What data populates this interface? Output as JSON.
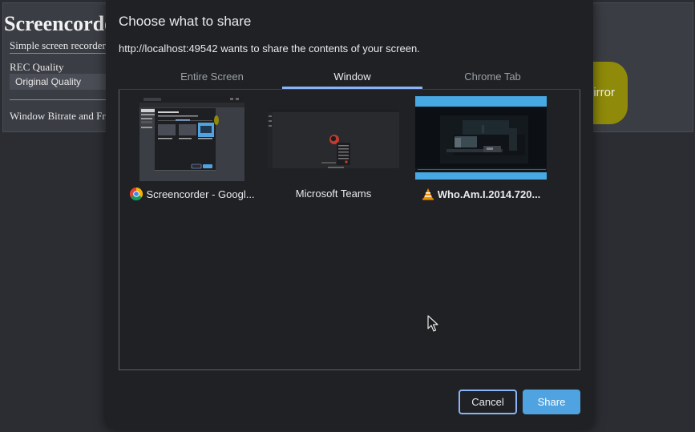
{
  "background_page": {
    "title": "Screencorde",
    "subtitle": "Simple screen recorder",
    "rec_quality_label": "REC Quality",
    "rec_quality_value": "Original Quality",
    "bitrate_label": "Window Bitrate and Fr",
    "mirror_button_label": "irror",
    "mirror_button_color": "#8f8a0a"
  },
  "dialog": {
    "title": "Choose what to share",
    "description": "http://localhost:49542 wants to share the contents of your screen.",
    "tabs": [
      {
        "label": "Entire Screen",
        "active": false
      },
      {
        "label": "Window",
        "active": true
      },
      {
        "label": "Chrome Tab",
        "active": false
      }
    ],
    "sources": [
      {
        "label": "Screencorder - Googl...",
        "icon": "chrome-icon",
        "bold": false
      },
      {
        "label": "Microsoft Teams",
        "icon": "",
        "bold": false
      },
      {
        "label": "Who.Am.I.2014.720...",
        "icon": "vlc-icon",
        "bold": true
      }
    ],
    "cancel_label": "Cancel",
    "share_label": "Share",
    "accent_color": "#8ab4f8",
    "share_button_color": "#4fa3e0"
  }
}
